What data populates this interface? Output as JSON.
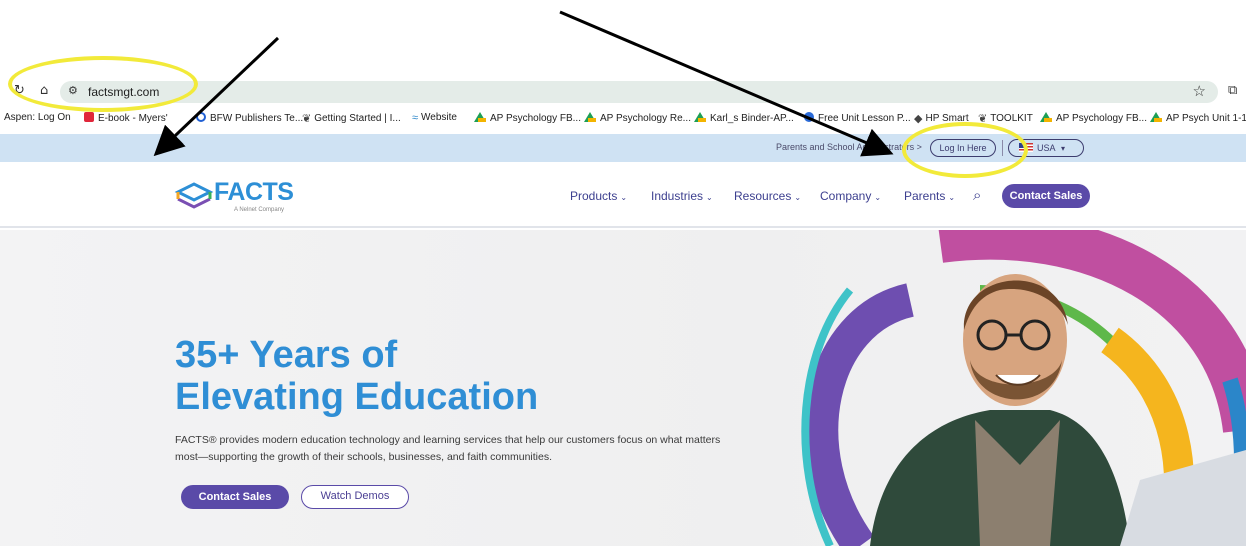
{
  "browser": {
    "url": "factsmgt.com",
    "back_icon": "reload-icon",
    "bookmark_star_icon": "star-icon"
  },
  "bookmarks": [
    {
      "label": "Aspen: Log On"
    },
    {
      "label": "E-book - Myers'"
    },
    {
      "label": "BFW Publishers Te..."
    },
    {
      "label": "Getting Started | I..."
    },
    {
      "label": "Website"
    },
    {
      "label": "AP Psychology FB..."
    },
    {
      "label": "AP Psychology Re..."
    },
    {
      "label": "Karl_s Binder-AP..."
    },
    {
      "label": "Free Unit Lesson P..."
    },
    {
      "label": "HP Smart"
    },
    {
      "label": "TOOLKIT"
    },
    {
      "label": "AP Psychology FB..."
    },
    {
      "label": "AP Psych Unit 1-1..."
    }
  ],
  "utility": {
    "parents_text": "Parents and School Administrators >",
    "login": "Log In Here",
    "country": "USA"
  },
  "nav": {
    "logo": "FACTS",
    "logo_sub": "A Nelnet Company",
    "items": [
      {
        "label": "Products"
      },
      {
        "label": "Industries"
      },
      {
        "label": "Resources"
      },
      {
        "label": "Company"
      },
      {
        "label": "Parents"
      }
    ],
    "contact": "Contact Sales"
  },
  "hero": {
    "title_line1": "35+ Years of",
    "title_line2": "Elevating Education",
    "description": "FACTS® provides modern education technology and learning services that help our customers focus on what matters most—supporting the growth of their schools, businesses, and faith communities.",
    "cta_primary": "Contact Sales",
    "cta_secondary": "Watch Demos"
  },
  "colors": {
    "brand_blue": "#2f8ed5",
    "brand_purple": "#5a4aa8",
    "utility_bar": "#cfe2f3",
    "annotation_yellow": "#f2ea3a"
  }
}
